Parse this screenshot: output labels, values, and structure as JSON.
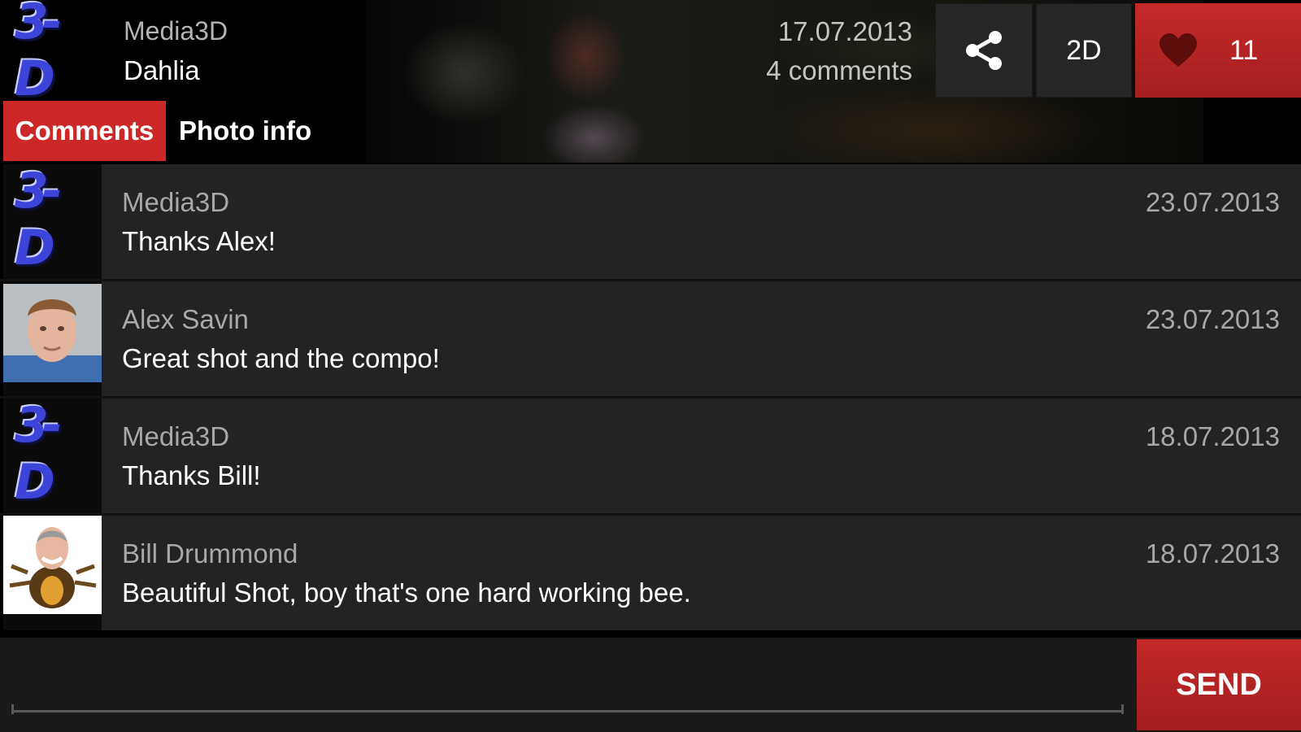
{
  "header": {
    "logo_text": "3-D",
    "author": "Media3D",
    "title": "Dahlia",
    "date": "17.07.2013",
    "comments_count": "4 comments",
    "mode_button": "2D",
    "like_count": "11",
    "share_icon": "share-icon",
    "like_icon": "heart-icon"
  },
  "tabs": [
    {
      "label": "Comments",
      "active": true
    },
    {
      "label": "Photo info",
      "active": false
    }
  ],
  "comments": [
    {
      "author": "Media3D",
      "text": "Thanks Alex!",
      "date": "23.07.2013",
      "avatar": "media3d-logo"
    },
    {
      "author": "Alex Savin",
      "text": "Great shot and the compo!",
      "date": "23.07.2013",
      "avatar": "photo"
    },
    {
      "author": "Media3D",
      "text": "Thanks Bill!",
      "date": "18.07.2013",
      "avatar": "media3d-logo"
    },
    {
      "author": "Bill Drummond",
      "text": "Beautiful Shot, boy that's one hard working bee.",
      "date": "18.07.2013",
      "avatar": "cartoon"
    }
  ],
  "composer": {
    "value": "",
    "placeholder": "",
    "send_label": "SEND"
  },
  "colors": {
    "accent": "#c62828",
    "background": "#000000",
    "row": "#232323"
  }
}
